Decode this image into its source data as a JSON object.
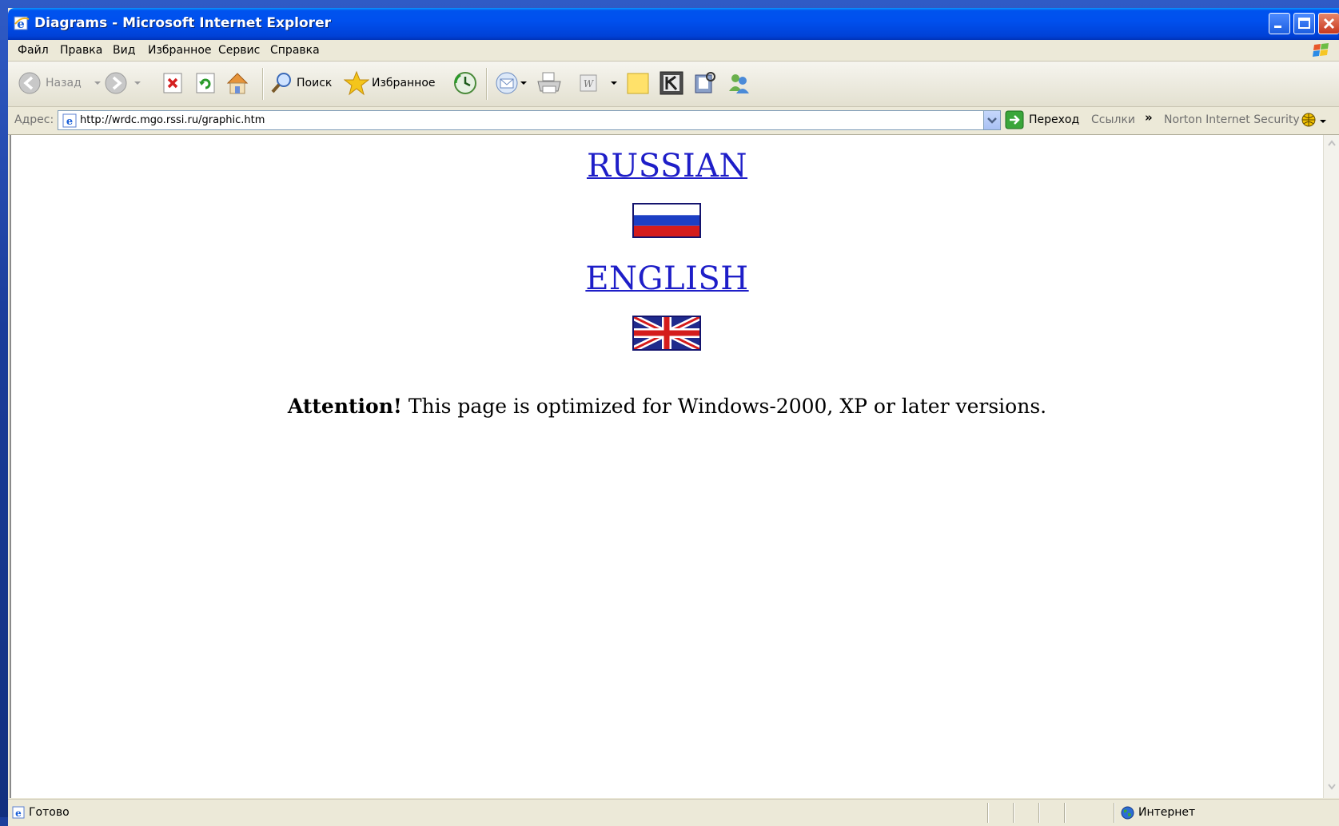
{
  "window": {
    "title": "Diagrams - Microsoft Internet Explorer"
  },
  "menu": {
    "items": [
      "Файл",
      "Правка",
      "Вид",
      "Избранное",
      "Сервис",
      "Справка"
    ]
  },
  "toolbar": {
    "back_label": "Назад",
    "search_label": "Поиск",
    "favorites_label": "Избранное"
  },
  "address": {
    "label": "Адрес:",
    "url": "http://wrdc.mgo.rssi.ru/graphic.htm",
    "go_label": "Переход",
    "links_label": "Ссылки",
    "chevron": "»",
    "norton_label": "Norton Internet Security"
  },
  "page": {
    "russian_link": "RUSSIAN",
    "english_link": "ENGLISH",
    "attention_bold": "Attention!",
    "attention_text": " This page is optimized for Windows-2000, XP or later versions."
  },
  "status": {
    "text": "Готово",
    "zone": "Интернет"
  },
  "colors": {
    "link": "#1e1ec8",
    "titlebar": "#0050ee"
  }
}
